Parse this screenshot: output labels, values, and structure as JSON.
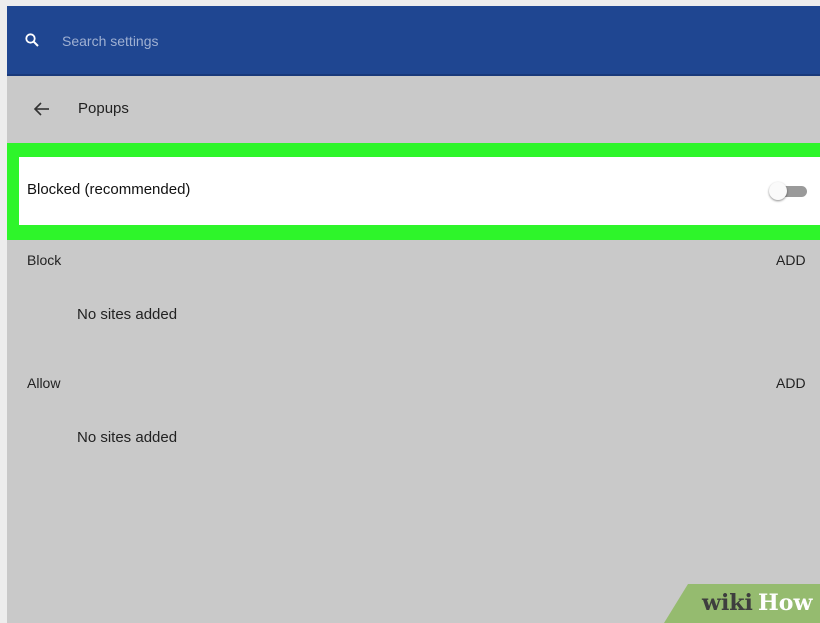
{
  "search": {
    "placeholder": "Search settings"
  },
  "header": {
    "title": "Popups"
  },
  "blocked_setting": {
    "label": "Blocked (recommended)",
    "enabled": false
  },
  "sections": [
    {
      "label": "Block",
      "action": "ADD",
      "empty_text": "No sites added"
    },
    {
      "label": "Allow",
      "action": "ADD",
      "empty_text": "No sites added"
    }
  ],
  "watermark": {
    "part1": "wiki",
    "part2": "How"
  },
  "colors": {
    "topbar": "#1f4691",
    "page_background": "#c9c9c9",
    "highlight": "#2ef52a",
    "card": "#ffffff",
    "watermark": "#95bb6f"
  },
  "icons": {
    "search": "search-icon",
    "back": "back-arrow-icon"
  }
}
